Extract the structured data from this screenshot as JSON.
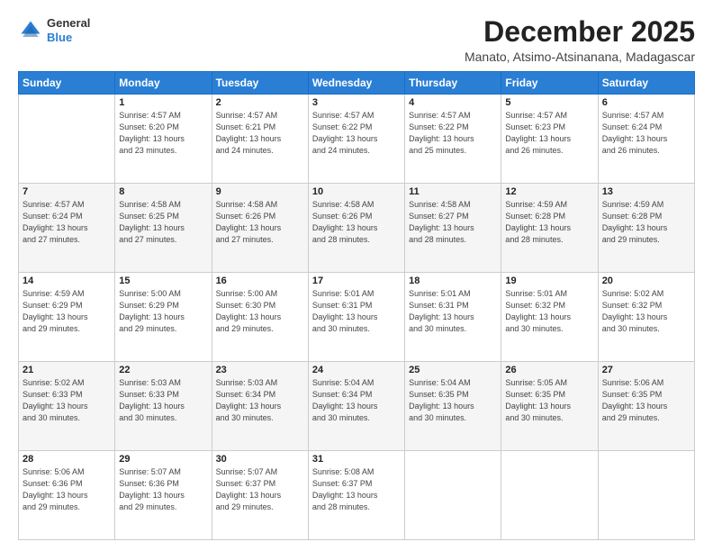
{
  "header": {
    "logo_general": "General",
    "logo_blue": "Blue",
    "month": "December 2025",
    "location": "Manato, Atsimo-Atsinanana, Madagascar"
  },
  "days_of_week": [
    "Sunday",
    "Monday",
    "Tuesday",
    "Wednesday",
    "Thursday",
    "Friday",
    "Saturday"
  ],
  "weeks": [
    [
      {
        "day": "",
        "info": ""
      },
      {
        "day": "1",
        "info": "Sunrise: 4:57 AM\nSunset: 6:20 PM\nDaylight: 13 hours\nand 23 minutes."
      },
      {
        "day": "2",
        "info": "Sunrise: 4:57 AM\nSunset: 6:21 PM\nDaylight: 13 hours\nand 24 minutes."
      },
      {
        "day": "3",
        "info": "Sunrise: 4:57 AM\nSunset: 6:22 PM\nDaylight: 13 hours\nand 24 minutes."
      },
      {
        "day": "4",
        "info": "Sunrise: 4:57 AM\nSunset: 6:22 PM\nDaylight: 13 hours\nand 25 minutes."
      },
      {
        "day": "5",
        "info": "Sunrise: 4:57 AM\nSunset: 6:23 PM\nDaylight: 13 hours\nand 26 minutes."
      },
      {
        "day": "6",
        "info": "Sunrise: 4:57 AM\nSunset: 6:24 PM\nDaylight: 13 hours\nand 26 minutes."
      }
    ],
    [
      {
        "day": "7",
        "info": "Sunrise: 4:57 AM\nSunset: 6:24 PM\nDaylight: 13 hours\nand 27 minutes."
      },
      {
        "day": "8",
        "info": "Sunrise: 4:58 AM\nSunset: 6:25 PM\nDaylight: 13 hours\nand 27 minutes."
      },
      {
        "day": "9",
        "info": "Sunrise: 4:58 AM\nSunset: 6:26 PM\nDaylight: 13 hours\nand 27 minutes."
      },
      {
        "day": "10",
        "info": "Sunrise: 4:58 AM\nSunset: 6:26 PM\nDaylight: 13 hours\nand 28 minutes."
      },
      {
        "day": "11",
        "info": "Sunrise: 4:58 AM\nSunset: 6:27 PM\nDaylight: 13 hours\nand 28 minutes."
      },
      {
        "day": "12",
        "info": "Sunrise: 4:59 AM\nSunset: 6:28 PM\nDaylight: 13 hours\nand 28 minutes."
      },
      {
        "day": "13",
        "info": "Sunrise: 4:59 AM\nSunset: 6:28 PM\nDaylight: 13 hours\nand 29 minutes."
      }
    ],
    [
      {
        "day": "14",
        "info": "Sunrise: 4:59 AM\nSunset: 6:29 PM\nDaylight: 13 hours\nand 29 minutes."
      },
      {
        "day": "15",
        "info": "Sunrise: 5:00 AM\nSunset: 6:29 PM\nDaylight: 13 hours\nand 29 minutes."
      },
      {
        "day": "16",
        "info": "Sunrise: 5:00 AM\nSunset: 6:30 PM\nDaylight: 13 hours\nand 29 minutes."
      },
      {
        "day": "17",
        "info": "Sunrise: 5:01 AM\nSunset: 6:31 PM\nDaylight: 13 hours\nand 30 minutes."
      },
      {
        "day": "18",
        "info": "Sunrise: 5:01 AM\nSunset: 6:31 PM\nDaylight: 13 hours\nand 30 minutes."
      },
      {
        "day": "19",
        "info": "Sunrise: 5:01 AM\nSunset: 6:32 PM\nDaylight: 13 hours\nand 30 minutes."
      },
      {
        "day": "20",
        "info": "Sunrise: 5:02 AM\nSunset: 6:32 PM\nDaylight: 13 hours\nand 30 minutes."
      }
    ],
    [
      {
        "day": "21",
        "info": "Sunrise: 5:02 AM\nSunset: 6:33 PM\nDaylight: 13 hours\nand 30 minutes."
      },
      {
        "day": "22",
        "info": "Sunrise: 5:03 AM\nSunset: 6:33 PM\nDaylight: 13 hours\nand 30 minutes."
      },
      {
        "day": "23",
        "info": "Sunrise: 5:03 AM\nSunset: 6:34 PM\nDaylight: 13 hours\nand 30 minutes."
      },
      {
        "day": "24",
        "info": "Sunrise: 5:04 AM\nSunset: 6:34 PM\nDaylight: 13 hours\nand 30 minutes."
      },
      {
        "day": "25",
        "info": "Sunrise: 5:04 AM\nSunset: 6:35 PM\nDaylight: 13 hours\nand 30 minutes."
      },
      {
        "day": "26",
        "info": "Sunrise: 5:05 AM\nSunset: 6:35 PM\nDaylight: 13 hours\nand 30 minutes."
      },
      {
        "day": "27",
        "info": "Sunrise: 5:06 AM\nSunset: 6:35 PM\nDaylight: 13 hours\nand 29 minutes."
      }
    ],
    [
      {
        "day": "28",
        "info": "Sunrise: 5:06 AM\nSunset: 6:36 PM\nDaylight: 13 hours\nand 29 minutes."
      },
      {
        "day": "29",
        "info": "Sunrise: 5:07 AM\nSunset: 6:36 PM\nDaylight: 13 hours\nand 29 minutes."
      },
      {
        "day": "30",
        "info": "Sunrise: 5:07 AM\nSunset: 6:37 PM\nDaylight: 13 hours\nand 29 minutes."
      },
      {
        "day": "31",
        "info": "Sunrise: 5:08 AM\nSunset: 6:37 PM\nDaylight: 13 hours\nand 28 minutes."
      },
      {
        "day": "",
        "info": ""
      },
      {
        "day": "",
        "info": ""
      },
      {
        "day": "",
        "info": ""
      }
    ]
  ]
}
